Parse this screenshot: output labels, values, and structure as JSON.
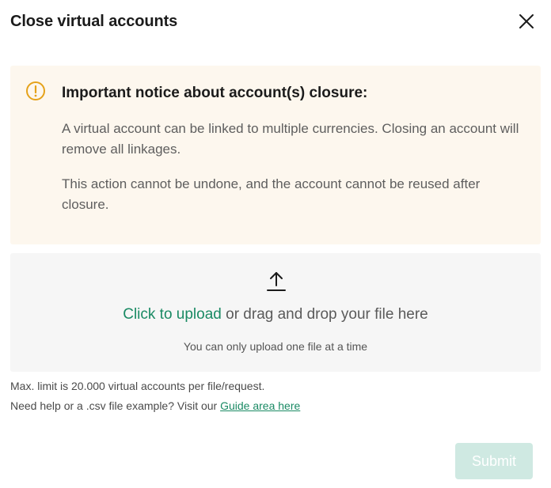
{
  "dialog": {
    "title": "Close virtual accounts",
    "close_icon": "close-icon"
  },
  "notice": {
    "icon": "warning-circle-icon",
    "icon_color": "#e5a21a",
    "background": "#fdf7ee",
    "title": "Important notice about account(s) closure:",
    "paragraph1": "A virtual account can be linked to multiple currencies. Closing an account will remove all linkages.",
    "paragraph2": "This action cannot be undone, and the account cannot be reused after closure."
  },
  "upload": {
    "icon": "upload-arrow-icon",
    "link_text": "Click to upload",
    "text": " or drag and drop your file here",
    "hint": "You can only upload one file at a time"
  },
  "footer": {
    "limit_text": "Max. limit is 20.000 virtual accounts per file/request.",
    "help_text": "Need help or a .csv file example? Visit our ",
    "guide_link": "Guide area here"
  },
  "actions": {
    "submit_label": "Submit",
    "submit_disabled": true
  },
  "colors": {
    "accent": "#1a8a64",
    "submit_disabled_bg": "#cfe9e2",
    "warning": "#e5a21a"
  }
}
